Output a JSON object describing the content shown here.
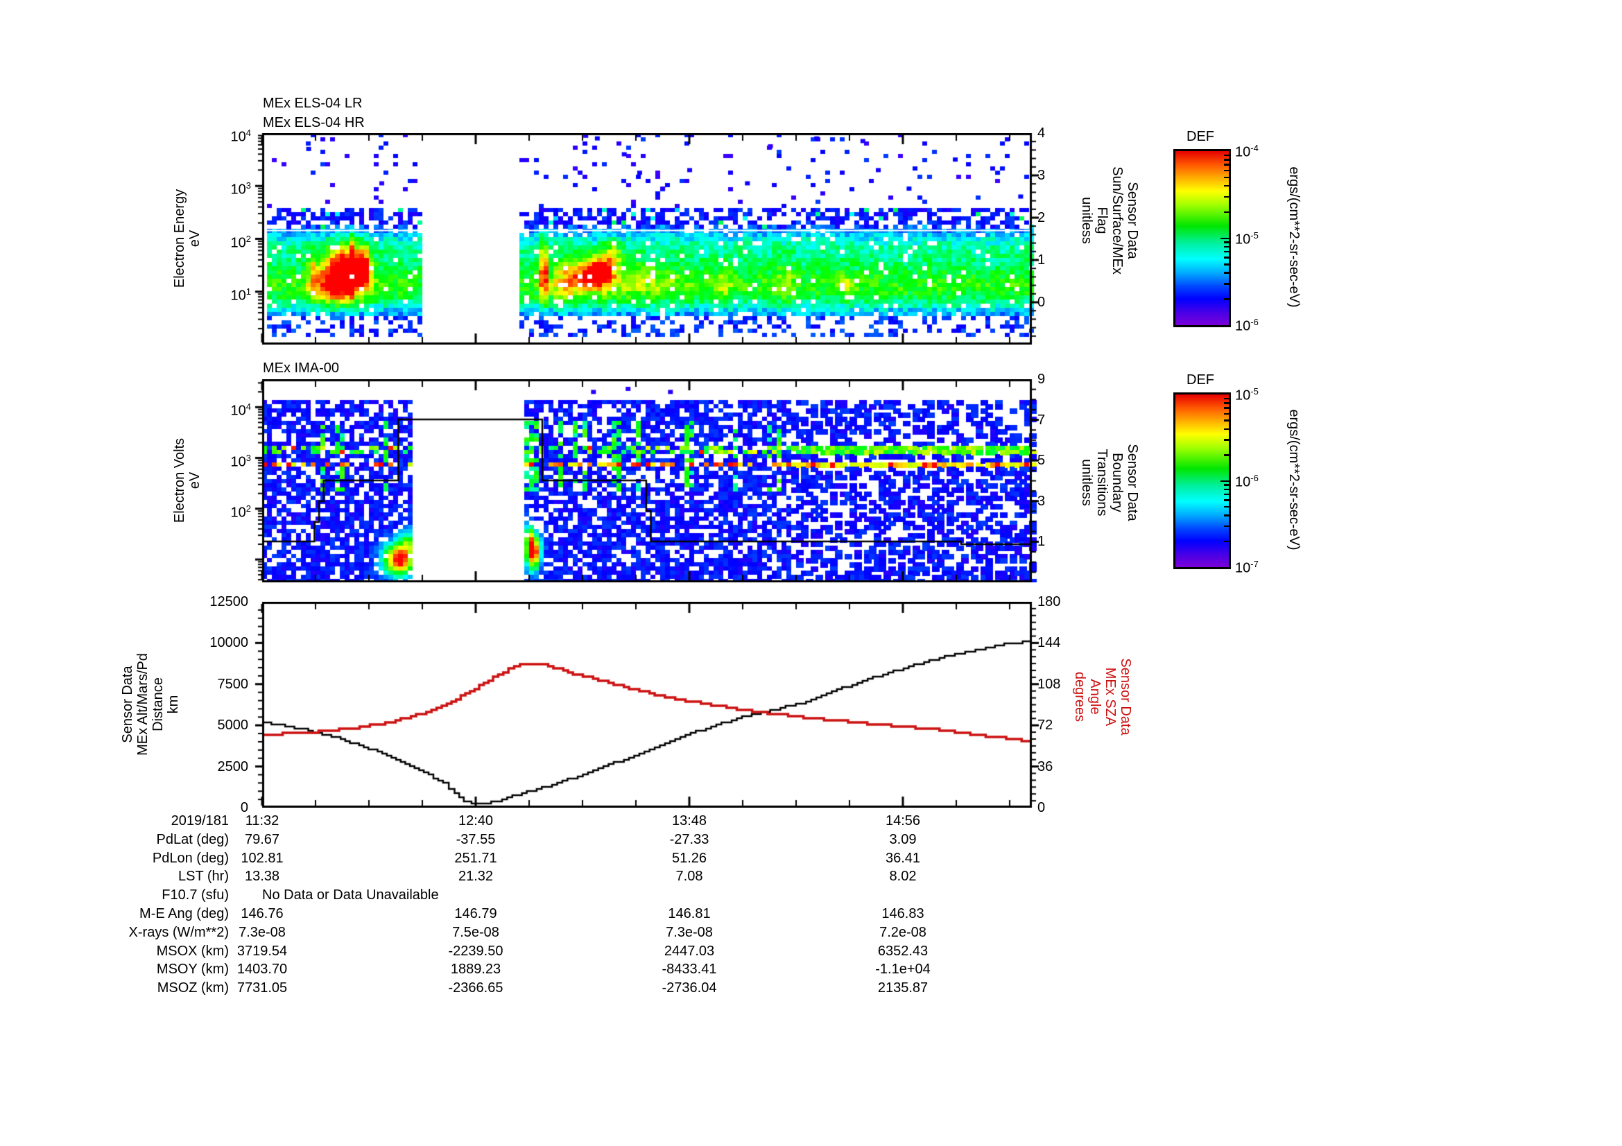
{
  "ui": {
    "background": "#ffffff",
    "accent_red": "#cc1111",
    "frame_color": "#000000"
  },
  "xaxis": {
    "date": "2019/181",
    "tick_labels": [
      "11:32",
      "12:40",
      "13:48",
      "14:56"
    ]
  },
  "table": {
    "rows": [
      {
        "label": "PdLat (deg)",
        "values": [
          "79.67",
          "-37.55",
          "-27.33",
          "3.09"
        ]
      },
      {
        "label": "PdLon (deg)",
        "values": [
          "102.81",
          "251.71",
          "51.26",
          "36.41"
        ]
      },
      {
        "label": "LST (hr)",
        "values": [
          "13.38",
          "21.32",
          "7.08",
          "8.02"
        ]
      },
      {
        "label": "F10.7 (sfu)",
        "values": [],
        "note": "No Data or Data Unavailable"
      },
      {
        "label": "M-E Ang (deg)",
        "values": [
          "146.76",
          "146.79",
          "146.81",
          "146.83"
        ]
      },
      {
        "label": "X-rays (W/m**2)",
        "values": [
          "7.3e-08",
          "7.5e-08",
          "7.3e-08",
          "7.2e-08"
        ]
      },
      {
        "label": "MSOX (km)",
        "values": [
          "3719.54",
          "-2239.50",
          "2447.03",
          "6352.43"
        ]
      },
      {
        "label": "MSOY (km)",
        "values": [
          "1403.70",
          "1889.23",
          "-8433.41",
          "-1.1e+04"
        ]
      },
      {
        "label": "MSOZ (km)",
        "values": [
          "7731.05",
          "-2366.65",
          "-2736.04",
          "2135.87"
        ]
      }
    ]
  },
  "chart_data": [
    {
      "type": "heatmap",
      "id": "els",
      "titles": [
        "MEx ELS-04 LR",
        "MEx ELS-04 HR"
      ],
      "ylabel_lines": [
        "Electron Energy",
        "eV"
      ],
      "y_axis": {
        "scale": "log",
        "range_log": [
          0,
          4
        ],
        "tick_labels": [
          "10^4",
          "10^3",
          "10^2",
          "10^1"
        ],
        "tick_logs": [
          4,
          3,
          2,
          1
        ]
      },
      "right_axis": {
        "label_lines": [
          "Sensor Data",
          "Sun/Surface/MEx",
          "Flag",
          "unitless"
        ],
        "range": [
          -1,
          4
        ],
        "tick_labels": [
          "4",
          "3",
          "2",
          "1",
          "0"
        ],
        "tick_values": [
          4,
          3,
          2,
          1,
          0
        ]
      },
      "colorbar": {
        "title": "DEF",
        "units": "ergs/(cm**2-sr-sec-eV)",
        "tick_labels": [
          "10^-4",
          "10^-5",
          "10^-6"
        ]
      },
      "features": {
        "x_gap_frac": [
          0.209,
          0.335
        ],
        "white_line_log_ev": 2.17,
        "core_band_log_ev": [
          0.8,
          1.5
        ],
        "hot_blobs": [
          [
            0.105,
            1.42,
            0.026,
            0.42,
            0.62
          ],
          [
            0.095,
            1.05,
            0.03,
            0.3,
            0.3
          ],
          [
            0.133,
            1.45,
            0.009,
            0.38,
            0.45
          ],
          [
            0.118,
            1.5,
            0.004,
            0.5,
            0.5
          ],
          [
            0.065,
            1.4,
            0.006,
            0.35,
            0.22
          ],
          [
            0.366,
            1.4,
            0.005,
            0.6,
            0.55
          ],
          [
            0.437,
            1.42,
            0.014,
            0.22,
            0.5
          ],
          [
            0.428,
            1.3,
            0.03,
            0.33,
            0.33
          ],
          [
            0.395,
            1.2,
            0.018,
            0.4,
            0.22
          ],
          [
            0.455,
            1.7,
            0.012,
            0.3,
            0.25
          ],
          [
            0.5,
            1.2,
            0.05,
            0.4,
            0.12
          ],
          [
            0.6,
            1.15,
            0.01,
            0.35,
            0.15
          ],
          [
            0.68,
            1.2,
            0.012,
            0.4,
            0.14
          ],
          [
            0.76,
            1.1,
            0.01,
            0.3,
            0.12
          ]
        ],
        "stray_points": [
          [
            0.06,
            3.7
          ],
          [
            0.155,
            3.05
          ],
          [
            0.42,
            3.95
          ],
          [
            0.435,
            3.9
          ],
          [
            0.47,
            3.6
          ],
          [
            0.49,
            3.25
          ],
          [
            0.52,
            2.95
          ],
          [
            0.555,
            3.3
          ],
          [
            0.63,
            3.05
          ],
          [
            0.66,
            3.75
          ],
          [
            0.72,
            3.9
          ],
          [
            0.78,
            3.85
          ],
          [
            0.8,
            3.3
          ],
          [
            0.84,
            2.95
          ],
          [
            0.9,
            3.5
          ],
          [
            0.955,
            3.25
          ],
          [
            0.985,
            2.8
          ]
        ]
      }
    },
    {
      "type": "heatmap",
      "id": "ima",
      "titles": [
        "MEx IMA-00"
      ],
      "ylabel_lines": [
        "Electron Volts",
        "eV"
      ],
      "y_axis": {
        "scale": "log",
        "range_log": [
          0.55,
          4.55
        ],
        "tick_labels": [
          "10^4",
          "10^3",
          "10^2"
        ],
        "tick_logs": [
          4,
          3,
          2
        ]
      },
      "right_axis": {
        "label_lines": [
          "Sensor Data",
          "Boundary",
          "Transitions",
          "unitless"
        ],
        "range": [
          -1,
          9
        ],
        "tick_labels": [
          "9",
          "7",
          "5",
          "3",
          "1"
        ],
        "tick_values": [
          9,
          7,
          5,
          3,
          1
        ]
      },
      "colorbar": {
        "title": "DEF",
        "units": "ergs/(cm**2-sr-sec-eV)",
        "tick_labels": [
          "10^-5",
          "10^-6",
          "10^-7"
        ]
      },
      "overlay_line": {
        "name": "boundary-transitions",
        "points": [
          [
            0,
            1
          ],
          [
            0.062,
            1
          ],
          [
            0.08,
            4
          ],
          [
            0.177,
            4
          ],
          [
            0.177,
            7
          ],
          [
            0.364,
            7
          ],
          [
            0.364,
            4
          ],
          [
            0.493,
            4
          ],
          [
            0.505,
            1
          ],
          [
            0.908,
            1
          ],
          [
            0.908,
            0.9
          ],
          [
            1,
            0.9
          ]
        ]
      },
      "features": {
        "x_gap_frac": [
          0.198,
          0.342
        ],
        "sparse_after_frac": 0.685,
        "streak_lines_log_ev": [
          3.13,
          2.87
        ],
        "blobs": [
          [
            0.178,
            1.0,
            0.02,
            0.3,
            0.85
          ],
          [
            0.19,
            1.35,
            0.012,
            0.25,
            0.3
          ],
          [
            0.352,
            1.15,
            0.009,
            0.33,
            0.9
          ],
          [
            0.347,
            1.5,
            0.006,
            0.2,
            0.35
          ]
        ],
        "stray_points": [
          [
            0.43,
            4.3
          ],
          [
            0.475,
            4.36
          ],
          [
            0.53,
            4.3
          ]
        ]
      }
    },
    {
      "type": "line",
      "id": "ephemeris",
      "ylabel_lines": [
        "Sensor Data",
        "MEx Alt/Mars/Pd",
        "Distance",
        "km"
      ],
      "y_axis": {
        "range": [
          0,
          12500
        ],
        "tick_labels": [
          "12500",
          "10000",
          "7500",
          "5000",
          "2500",
          "0"
        ],
        "tick_values": [
          12500,
          10000,
          7500,
          5000,
          2500,
          0
        ]
      },
      "right_axis": {
        "label_lines": [
          "Sensor Data",
          "MEx SZA",
          "Angle",
          "degrees"
        ],
        "color": "#cc1111",
        "range": [
          0,
          180
        ],
        "tick_labels": [
          "180",
          "144",
          "108",
          "72",
          "36",
          "0"
        ],
        "tick_values": [
          180,
          144,
          108,
          72,
          36,
          0
        ]
      },
      "series": [
        {
          "name": "MEx Alt/Mars/Pd Distance",
          "units": "km",
          "color": "#000000",
          "axis": "left",
          "points": [
            [
              0,
              5200
            ],
            [
              0.03,
              4980
            ],
            [
              0.06,
              4680
            ],
            [
              0.09,
              4320
            ],
            [
              0.12,
              3890
            ],
            [
              0.15,
              3400
            ],
            [
              0.18,
              2820
            ],
            [
              0.21,
              2130
            ],
            [
              0.235,
              1520
            ],
            [
              0.25,
              850
            ],
            [
              0.262,
              420
            ],
            [
              0.272,
              290
            ],
            [
              0.29,
              300
            ],
            [
              0.305,
              430
            ],
            [
              0.325,
              700
            ],
            [
              0.35,
              1050
            ],
            [
              0.39,
              1600
            ],
            [
              0.43,
              2250
            ],
            [
              0.47,
              2950
            ],
            [
              0.51,
              3680
            ],
            [
              0.55,
              4400
            ],
            [
              0.59,
              5050
            ],
            [
              0.63,
              5600
            ],
            [
              0.66,
              5900
            ],
            [
              0.7,
              6350
            ],
            [
              0.74,
              7050
            ],
            [
              0.78,
              7700
            ],
            [
              0.82,
              8300
            ],
            [
              0.86,
              8850
            ],
            [
              0.9,
              9330
            ],
            [
              0.94,
              9720
            ],
            [
              0.97,
              9960
            ],
            [
              1,
              10150
            ]
          ]
        },
        {
          "name": "MEx SZA Angle",
          "units": "degrees",
          "color": "#cc1111",
          "axis": "right",
          "points": [
            [
              0,
              64
            ],
            [
              0.04,
              65
            ],
            [
              0.08,
              67
            ],
            [
              0.12,
              70
            ],
            [
              0.16,
              74
            ],
            [
              0.2,
              81
            ],
            [
              0.24,
              91
            ],
            [
              0.27,
              102
            ],
            [
              0.3,
              114
            ],
            [
              0.32,
              121
            ],
            [
              0.335,
              125
            ],
            [
              0.365,
              125
            ],
            [
              0.385,
              121
            ],
            [
              0.41,
              116
            ],
            [
              0.45,
              109
            ],
            [
              0.49,
              102
            ],
            [
              0.53,
              96
            ],
            [
              0.57,
              91
            ],
            [
              0.61,
              87
            ],
            [
              0.65,
              83
            ],
            [
              0.69,
              80
            ],
            [
              0.73,
              77
            ],
            [
              0.78,
              74
            ],
            [
              0.83,
              71
            ],
            [
              0.88,
              68
            ],
            [
              0.92,
              64
            ],
            [
              0.96,
              61
            ],
            [
              1,
              58
            ]
          ]
        }
      ]
    }
  ]
}
